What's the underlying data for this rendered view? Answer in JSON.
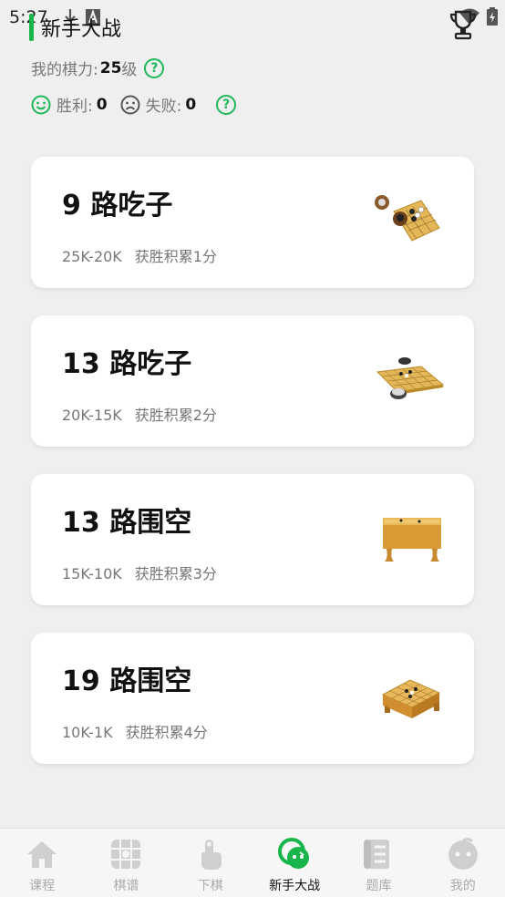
{
  "status": {
    "time": "5:27"
  },
  "header": {
    "title": "新手大战",
    "rating_label": "我的棋力:",
    "rating_value": "25",
    "rating_unit": "级",
    "help_glyph": "?",
    "win_label": "胜利:",
    "win_count": "0",
    "loss_label": "失败:",
    "loss_count": "0"
  },
  "cards": [
    {
      "title": "9 路吃子",
      "range": "25K-20K",
      "reward": "获胜积累1分"
    },
    {
      "title": "13 路吃子",
      "range": "20K-15K",
      "reward": "获胜积累2分"
    },
    {
      "title": "13 路围空",
      "range": "15K-10K",
      "reward": "获胜积累3分"
    },
    {
      "title": "19 路围空",
      "range": "10K-1K",
      "reward": "获胜积累4分"
    }
  ],
  "nav": [
    {
      "label": "课程",
      "icon": "house-icon"
    },
    {
      "label": "棋谱",
      "icon": "board-grid-icon"
    },
    {
      "label": "下棋",
      "icon": "hand-tap-icon"
    },
    {
      "label": "新手大战",
      "icon": "battle-icon",
      "active": true
    },
    {
      "label": "题库",
      "icon": "scroll-icon"
    },
    {
      "label": "我的",
      "icon": "profile-icon"
    }
  ],
  "colors": {
    "accent": "#18b64a",
    "background": "#efefef",
    "card": "#ffffff",
    "inactive": "#aaaaaa"
  }
}
